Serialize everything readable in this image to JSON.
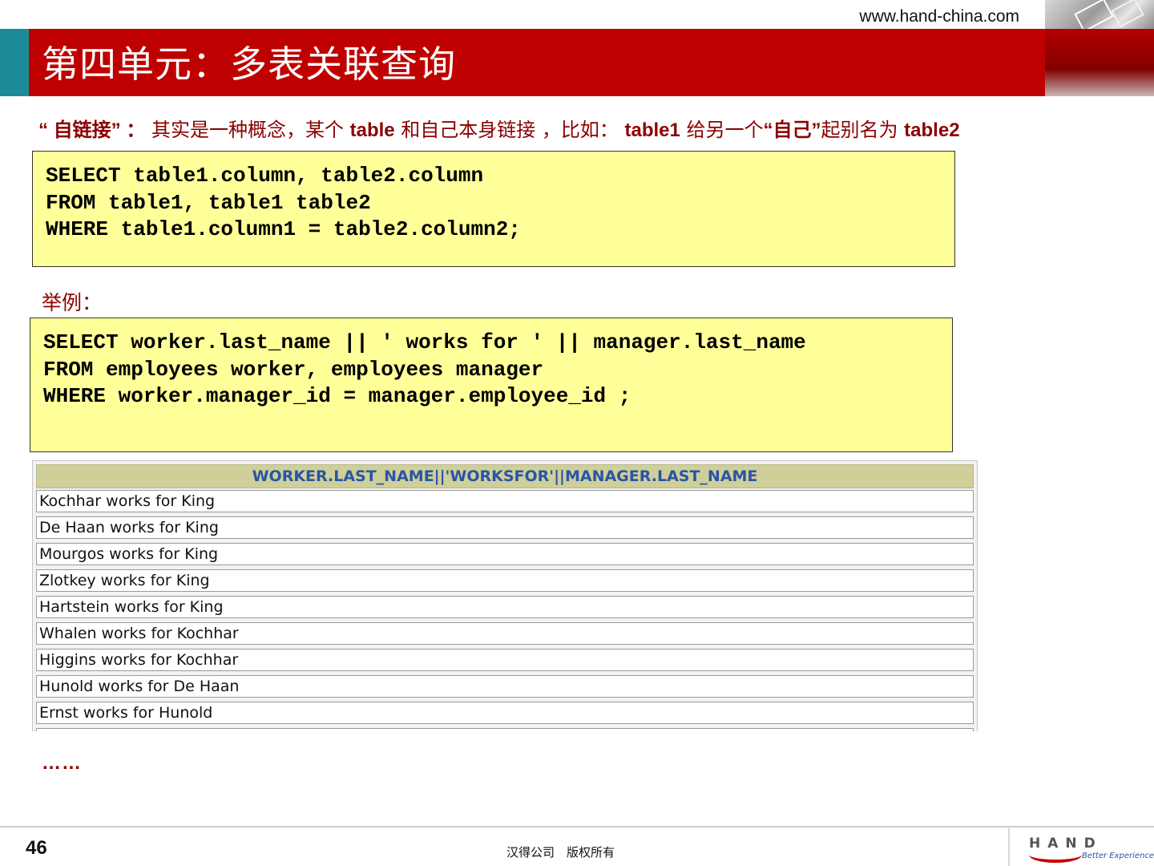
{
  "header": {
    "url": "www.hand-china.com",
    "title": "第四单元：多表关联查询"
  },
  "intro": {
    "term": "“ 自链接” ：",
    "text1": " 其实是一种概念，某个 ",
    "kw1": "table",
    "text2": " 和自己本身链接 ，比如： ",
    "kw2": "table1",
    "text3": " 给另一个",
    "quote": "“自己”",
    "text4": "起别名为 ",
    "kw3": "table2"
  },
  "syntax_code": [
    "SELECT table1.column, table2.column",
    "FROM table1, table1 table2",
    "WHERE table1.column1 = table2.column2;"
  ],
  "example_label": "举例：",
  "example_code": [
    "SELECT worker.last_name || ' works for ' || manager.last_name",
    "FROM employees worker, employees manager",
    "WHERE worker.manager_id = manager.employee_id ;"
  ],
  "result": {
    "header": "WORKER.LAST_NAME||'WORKSFOR'||MANAGER.LAST_NAME",
    "rows": [
      "Kochhar works for King",
      "De Haan works for King",
      "Mourgos works for King",
      "Zlotkey works for King",
      "Hartstein works for King",
      "Whalen works for Kochhar",
      "Higgins works for Kochhar",
      "Hunold works for De Haan",
      "Ernst works for Hunold"
    ]
  },
  "ellipsis": "……",
  "footer": {
    "page_number": "46",
    "copyright": "汉得公司　版权所有",
    "logo_text": "HAND",
    "logo_tagline": "Better Experience"
  },
  "colors": {
    "banner": "#bf0000",
    "accent_teal": "#1b8b97",
    "code_bg": "#ffff99",
    "text_dark_red": "#8b0000"
  }
}
